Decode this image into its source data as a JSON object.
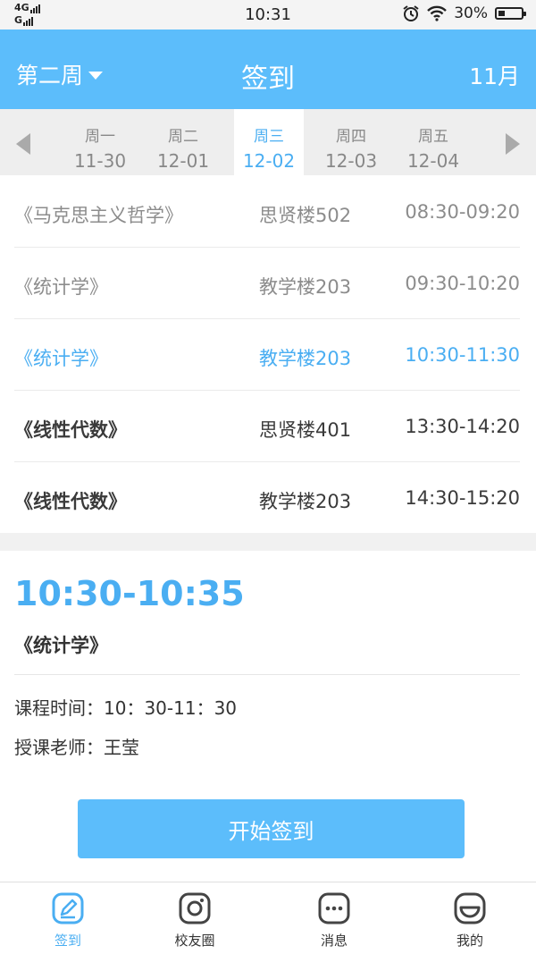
{
  "status_bar": {
    "network_top": "4G",
    "network_bottom": "G",
    "time": "10:31",
    "battery": "30%",
    "battery_level": 0.3,
    "icons": [
      "alarm-icon",
      "wifi-icon",
      "battery-icon"
    ]
  },
  "header": {
    "week": "第二周",
    "title": "签到",
    "month": "11月"
  },
  "days": [
    {
      "name": "周一",
      "date": "11-30"
    },
    {
      "name": "周二",
      "date": "12-01"
    },
    {
      "name": "周三",
      "date": "12-02"
    },
    {
      "name": "周四",
      "date": "12-03"
    },
    {
      "name": "周五",
      "date": "12-04"
    }
  ],
  "active_day_index": 2,
  "courses": [
    {
      "name": "《马克思主义哲学》",
      "room": "思贤楼502",
      "time": "08:30-09:20",
      "state": "past"
    },
    {
      "name": "《统计学》",
      "room": "教学楼203",
      "time": "09:30-10:20",
      "state": "past"
    },
    {
      "name": "《统计学》",
      "room": "教学楼203",
      "time": "10:30-11:30",
      "state": "current"
    },
    {
      "name": "《线性代数》",
      "room": "思贤楼401",
      "time": "13:30-14:20",
      "state": "future"
    },
    {
      "name": "《线性代数》",
      "room": "教学楼203",
      "time": "14:30-15:20",
      "state": "future"
    }
  ],
  "detail": {
    "checkin_window": "10:30-10:35",
    "course_name": "《统计学》",
    "course_time": "课程时间：10：30-11：30",
    "teacher": "授课老师：王莹",
    "button_label": "开始签到"
  },
  "tabs": [
    {
      "label": "签到",
      "icon": "pencil-icon",
      "active": true
    },
    {
      "label": "校友圈",
      "icon": "camera-icon",
      "active": false
    },
    {
      "label": "消息",
      "icon": "chat-icon",
      "active": false
    },
    {
      "label": "我的",
      "icon": "smile-icon",
      "active": false
    }
  ],
  "colors": {
    "accent": "#5cbdfb",
    "accent_text": "#4aaef2"
  }
}
